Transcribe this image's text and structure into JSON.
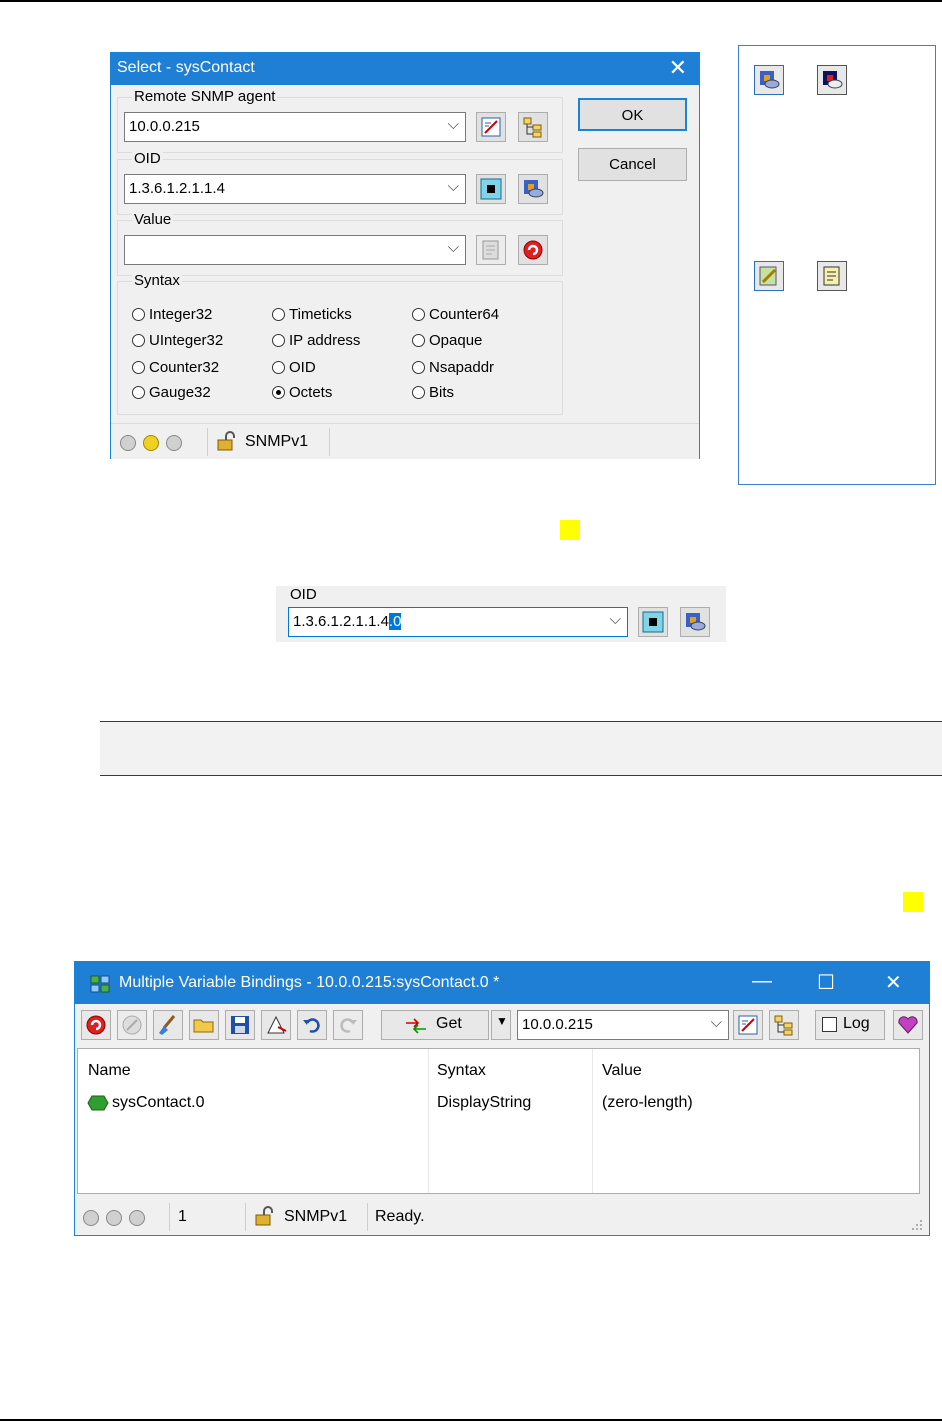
{
  "dialog": {
    "title": "Select - sysContact",
    "close_glyph": "✕",
    "remote_agent_label": "Remote SNMP agent",
    "remote_agent_value": "10.0.0.215",
    "oid_label": "OID",
    "oid_value": "1.3.6.1.2.1.1.4",
    "value_label": "Value",
    "value_value": "",
    "syntax_label": "Syntax",
    "syntax_options": [
      "Integer32",
      "Timeticks",
      "Counter64",
      "UInteger32",
      "IP address",
      "Opaque",
      "Counter32",
      "OID",
      "Nsapaddr",
      "Gauge32",
      "Octets",
      "Bits"
    ],
    "syntax_selected": "Octets",
    "ok_label": "OK",
    "cancel_label": "Cancel",
    "status_version": "SNMPv1"
  },
  "oid_snippet": {
    "label": "OID",
    "value_prefix": "1.3.6.1.2.1.1.4",
    "value_selected": ".0"
  },
  "mvb": {
    "title": "Multiple Variable Bindings - 10.0.0.215:sysContact.0 *",
    "min_glyph": "—",
    "max_glyph": "☐",
    "close_glyph": "✕",
    "get_label": "Get",
    "agent_value": "10.0.0.215",
    "log_label": "Log",
    "columns": [
      "Name",
      "Syntax",
      "Value"
    ],
    "rows": [
      {
        "name": "sysContact.0",
        "syntax": "DisplayString",
        "value": "(zero-length)"
      }
    ],
    "status_count": "1",
    "status_version": "SNMPv1",
    "status_text": "Ready."
  },
  "colors": {
    "title_bar": "#1f7fd4",
    "highlight": "#ffff00",
    "band_border": "#c00000",
    "selection": "#0078d7"
  }
}
